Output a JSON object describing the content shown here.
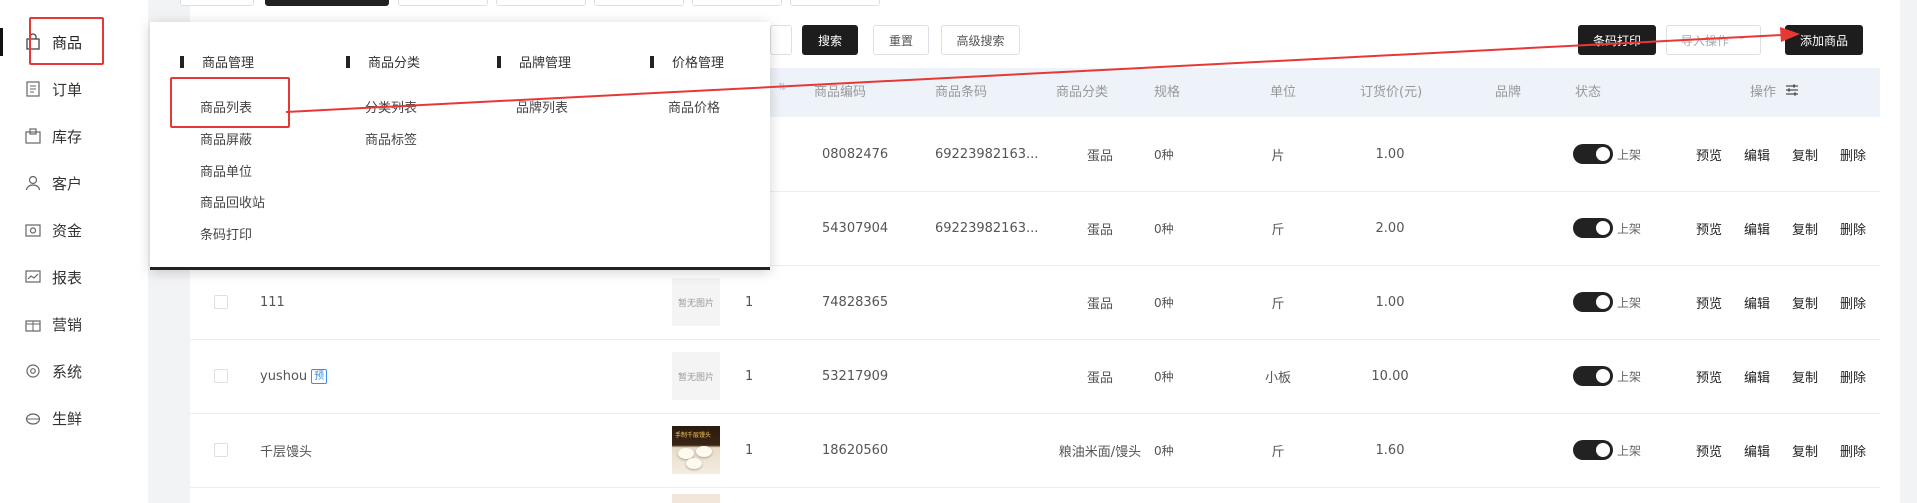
{
  "sidebar": {
    "items": [
      {
        "label": "商品",
        "icon": "bag-icon"
      },
      {
        "label": "订单",
        "icon": "order-icon"
      },
      {
        "label": "库存",
        "icon": "inventory-icon"
      },
      {
        "label": "客户",
        "icon": "user-icon"
      },
      {
        "label": "资金",
        "icon": "funds-icon"
      },
      {
        "label": "报表",
        "icon": "report-icon"
      },
      {
        "label": "营销",
        "icon": "gift-icon"
      },
      {
        "label": "系统",
        "icon": "gear-icon"
      },
      {
        "label": "生鲜",
        "icon": "fresh-icon"
      }
    ],
    "active": "商品"
  },
  "toolbar": {
    "search_label": "搜索",
    "reset_label": "重置",
    "advanced_label": "高级搜索",
    "barcode_print_label": "条码打印",
    "import_label": "导入操作",
    "add_label": "添加商品"
  },
  "table": {
    "headers": {
      "code": "商品编码",
      "barcode": "商品条码",
      "category": "商品分类",
      "spec": "规格",
      "unit": "单位",
      "price": "订货价(元)",
      "brand": "品牌",
      "status": "状态",
      "ops": "操作"
    },
    "rows": [
      {
        "name": "",
        "tag": "",
        "image": "",
        "qty": "",
        "code": "08082476",
        "barcode": "69223982163...",
        "category": "蛋品",
        "spec": "0种",
        "unit": "片",
        "price": "1.00",
        "status": "上架"
      },
      {
        "name": "",
        "tag": "",
        "image": "",
        "qty": "",
        "code": "54307904",
        "barcode": "69223982163...",
        "category": "蛋品",
        "spec": "0种",
        "unit": "斤",
        "price": "2.00",
        "status": "上架"
      },
      {
        "name": "111",
        "tag": "",
        "image": "暂无图片",
        "qty": "1",
        "code": "74828365",
        "barcode": "",
        "category": "蛋品",
        "spec": "0种",
        "unit": "斤",
        "price": "1.00",
        "status": "上架"
      },
      {
        "name": "yushou",
        "tag": "预",
        "image": "暂无图片",
        "qty": "1",
        "code": "53217909",
        "barcode": "",
        "category": "蛋品",
        "spec": "0种",
        "unit": "小板",
        "price": "10.00",
        "status": "上架"
      },
      {
        "name": "千层馒头",
        "tag": "",
        "image": "手制千层馒头",
        "qty": "1",
        "code": "18620560",
        "barcode": "",
        "category": "粮油米面/馒头",
        "spec": "0种",
        "unit": "斤",
        "price": "1.60",
        "status": "上架"
      }
    ],
    "ops": {
      "preview": "预览",
      "edit": "编辑",
      "copy": "复制",
      "delete": "删除"
    }
  },
  "menu": {
    "columns": [
      {
        "title": "商品管理",
        "items": [
          "商品列表",
          "商品屏蔽",
          "商品单位",
          "商品回收站",
          "条码打印"
        ]
      },
      {
        "title": "商品分类",
        "items": [
          "分类列表",
          "商品标签"
        ]
      },
      {
        "title": "品牌管理",
        "items": [
          "品牌列表"
        ]
      },
      {
        "title": "价格管理",
        "items": [
          "商品价格"
        ]
      }
    ]
  },
  "colors": {
    "accent": "#1d1d1d",
    "annotation": "#e53935",
    "header_bg": "#eef2f9",
    "tag_blue": "#3b8eea"
  }
}
